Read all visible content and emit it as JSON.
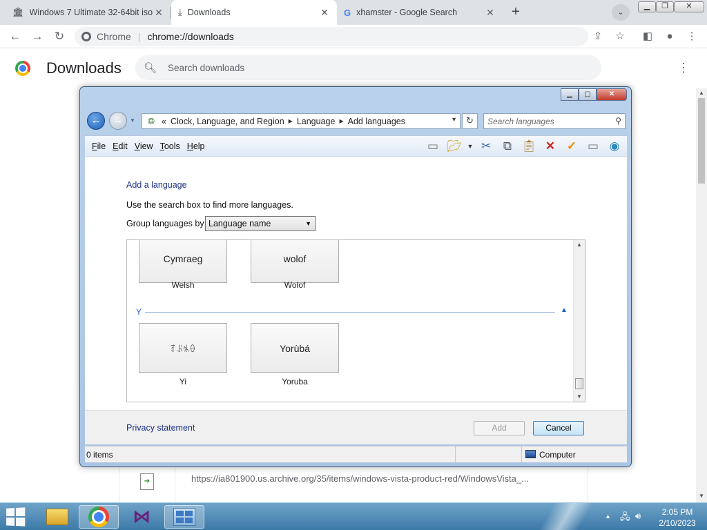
{
  "browser": {
    "tabs": [
      {
        "title": "Windows 7 Ultimate 32-64bit iso",
        "icon": "archive-icon"
      },
      {
        "title": "Downloads",
        "icon": "download-icon"
      },
      {
        "title": "xhamster - Google Search",
        "icon": "google-icon"
      }
    ],
    "omnibox": {
      "site": "Chrome",
      "separator": "|",
      "url": "chrome://downloads"
    }
  },
  "downloads_page": {
    "title": "Downloads",
    "search_placeholder": "Search downloads",
    "item_url": "https://ia801900.us.archive.org/35/items/windows-vista-product-red/WindowsVista_..."
  },
  "dialog": {
    "address": {
      "prefix": "«",
      "parts": [
        "Clock, Language, and Region",
        "Language",
        "Add languages"
      ]
    },
    "search_placeholder": "Search languages",
    "menu": [
      {
        "accel": "F",
        "rest": "ile"
      },
      {
        "accel": "E",
        "rest": "dit"
      },
      {
        "accel": "V",
        "rest": "iew"
      },
      {
        "accel": "T",
        "rest": "ools"
      },
      {
        "accel": "H",
        "rest": "elp"
      }
    ],
    "heading": "Add a language",
    "hint": "Use the search box to find more languages.",
    "group_by_label": "Group languages by:",
    "group_by_value": "Language name",
    "group_header": "Y",
    "languages": [
      {
        "native": "Cymraeg",
        "english": "Welsh"
      },
      {
        "native": "wolof",
        "english": "Wolof"
      },
      {
        "native": "ꆈꌠꁱꂷ",
        "english": "Yi"
      },
      {
        "native": "Yorùbá",
        "english": "Yoruba"
      }
    ],
    "privacy_link": "Privacy statement",
    "add_button": "Add",
    "cancel_button": "Cancel",
    "status": {
      "items": "0 items",
      "zone": "Computer"
    }
  },
  "taskbar": {
    "time": "2:05 PM",
    "date": "2/10/2023"
  },
  "colors": {
    "link_blue": "#1e3287",
    "taskbar": "#3c7aa8",
    "chrome_tabstrip": "#dee1e6"
  }
}
